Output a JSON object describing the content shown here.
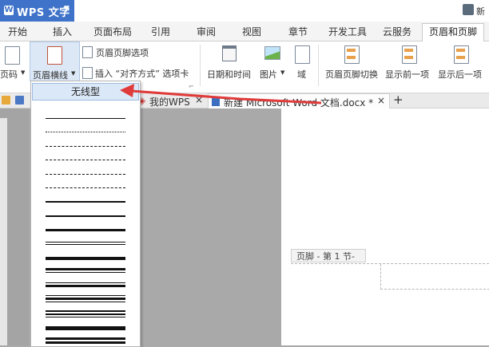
{
  "app": {
    "title": "WPS 文字",
    "top_right_text": "新"
  },
  "tabs": [
    {
      "label": "开始"
    },
    {
      "label": "插入"
    },
    {
      "label": "页面布局"
    },
    {
      "label": "引用"
    },
    {
      "label": "审阅"
    },
    {
      "label": "视图"
    },
    {
      "label": "章节"
    },
    {
      "label": "开发工具"
    },
    {
      "label": "云服务"
    },
    {
      "label": "页眉和页脚",
      "active": true
    }
  ],
  "ribbon": {
    "page_number": "页码",
    "header_line": "页眉横线",
    "header_footer_options": "页眉页脚选项",
    "insert_align_tab": "插入 “对齐方式” 选项卡",
    "date_time": "日期和时间",
    "picture": "图片",
    "field": "域",
    "switch_header_footer": "页眉页脚切换",
    "show_previous": "显示前一项",
    "show_next": "显示后一项"
  },
  "doc_tabs": {
    "my_wps": "我的WPS",
    "current_doc": "新建 Microsoft Word 文档.docx *",
    "close_symbol": "×",
    "add_symbol": "+"
  },
  "footer_tag": "页脚 - 第 1 节-",
  "dropdown": {
    "no_line": "无线型",
    "line_styles": [
      {
        "style": "solid",
        "width": 1
      },
      {
        "style": "dotted",
        "width": 1
      },
      {
        "style": "dashed-short",
        "width": 1
      },
      {
        "style": "dashed",
        "width": 1
      },
      {
        "style": "dash-dot",
        "width": 1
      },
      {
        "style": "dash-dot-dot",
        "width": 1
      },
      {
        "style": "solid",
        "width": 2
      },
      {
        "style": "solid",
        "width": 2.5
      },
      {
        "style": "solid",
        "width": 3
      },
      {
        "style": "double-thin",
        "width": 1
      },
      {
        "style": "solid",
        "width": 4
      },
      {
        "style": "thick-thin",
        "width": 3
      },
      {
        "style": "thin-thick",
        "width": 3
      },
      {
        "style": "thin-thick-thin",
        "width": 3
      },
      {
        "style": "triple",
        "width": 2
      },
      {
        "style": "solid",
        "width": 5
      },
      {
        "style": "double-thick",
        "width": 3
      },
      {
        "style": "thin",
        "width": 1
      }
    ]
  },
  "colors": {
    "accent": "#3f73c9",
    "arrow": "#e03a3a",
    "selected": "#dbe8f7"
  },
  "icons": [
    "page-number-icon",
    "header-line-icon",
    "options-icon",
    "align-tab-icon",
    "calendar-icon",
    "picture-icon",
    "field-icon",
    "switch-icon",
    "previous-icon",
    "next-icon",
    "folder-icon",
    "save-icon"
  ]
}
